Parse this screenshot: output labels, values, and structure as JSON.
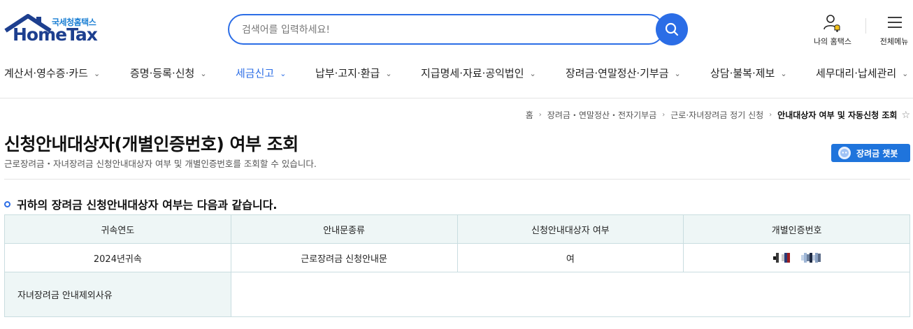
{
  "header": {
    "logo_sub": "국세청홈택스",
    "logo_main": "HomeTax",
    "search_placeholder": "검색어를 입력하세요!",
    "my_hometax": "나의 홈택스",
    "all_menu": "전체메뉴"
  },
  "gnb": [
    {
      "label": "계산서·영수증·카드",
      "active": false
    },
    {
      "label": "증명·등록·신청",
      "active": false
    },
    {
      "label": "세금신고",
      "active": true
    },
    {
      "label": "납부·고지·환급",
      "active": false
    },
    {
      "label": "지급명세·자료·공익법인",
      "active": false
    },
    {
      "label": "장려금·연말정산·기부금",
      "active": false
    },
    {
      "label": "상담·불복·제보",
      "active": false
    },
    {
      "label": "세무대리·납세관리",
      "active": false
    }
  ],
  "breadcrumb": {
    "home": "홈",
    "level1": "장려금・연말정산・전자기부금",
    "level2": "근로·자녀장려금 정기 신청",
    "current": "안내대상자 여부 및 자동신청 조회"
  },
  "page": {
    "title": "신청안내대상자(개별인증번호) 여부 조회",
    "description": "근로장려금・자녀장려금 신청안내대상자 여부 및 개별인증번호를 조회할 수 있습니다.",
    "chatbot_label": "장려금 챗봇"
  },
  "section": {
    "heading": "귀하의 장려금 신청안내대상자 여부는 다음과 같습니다."
  },
  "table": {
    "headers": [
      "귀속연도",
      "안내문종류",
      "신청안내대상자 여부",
      "개별인증번호"
    ],
    "row": {
      "year": "2024년귀속",
      "notice_type": "근로장려금 신청안내문",
      "eligible": "여"
    },
    "exclusion_label": "자녀장려금 안내제외사유",
    "exclusion_value": ""
  },
  "colors": {
    "accent": "#2b6de6",
    "logo_navy": "#1d3f8f",
    "table_head_bg": "#eef6f6",
    "table_border": "#c9dde0"
  }
}
